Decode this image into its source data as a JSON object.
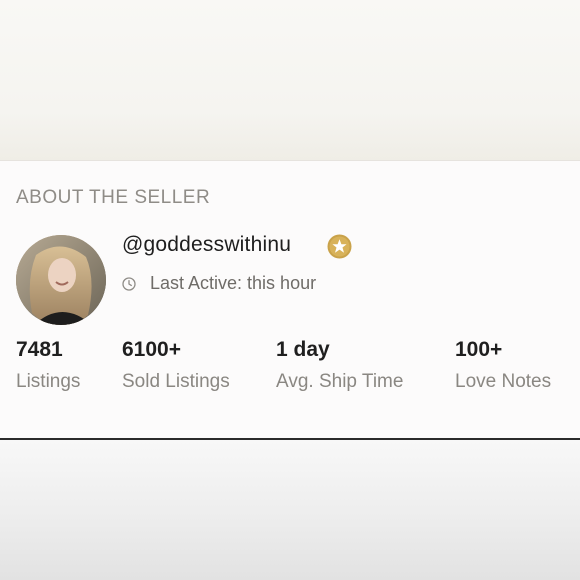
{
  "section_title": "ABOUT THE SELLER",
  "seller": {
    "username": "@goddesswithinu",
    "badge_icon": "gold-star-badge",
    "last_active": "Last Active: this hour"
  },
  "stats": [
    {
      "value": "7481",
      "label": "Listings"
    },
    {
      "value": "6100+",
      "label": "Sold Listings"
    },
    {
      "value": "1 day",
      "label": "Avg. Ship Time"
    },
    {
      "value": "100+",
      "label": "Love Notes"
    }
  ],
  "colors": {
    "badge_gold": "#c9a24a",
    "title_gray": "#8f8c87",
    "divider": "#2b2b2b"
  }
}
